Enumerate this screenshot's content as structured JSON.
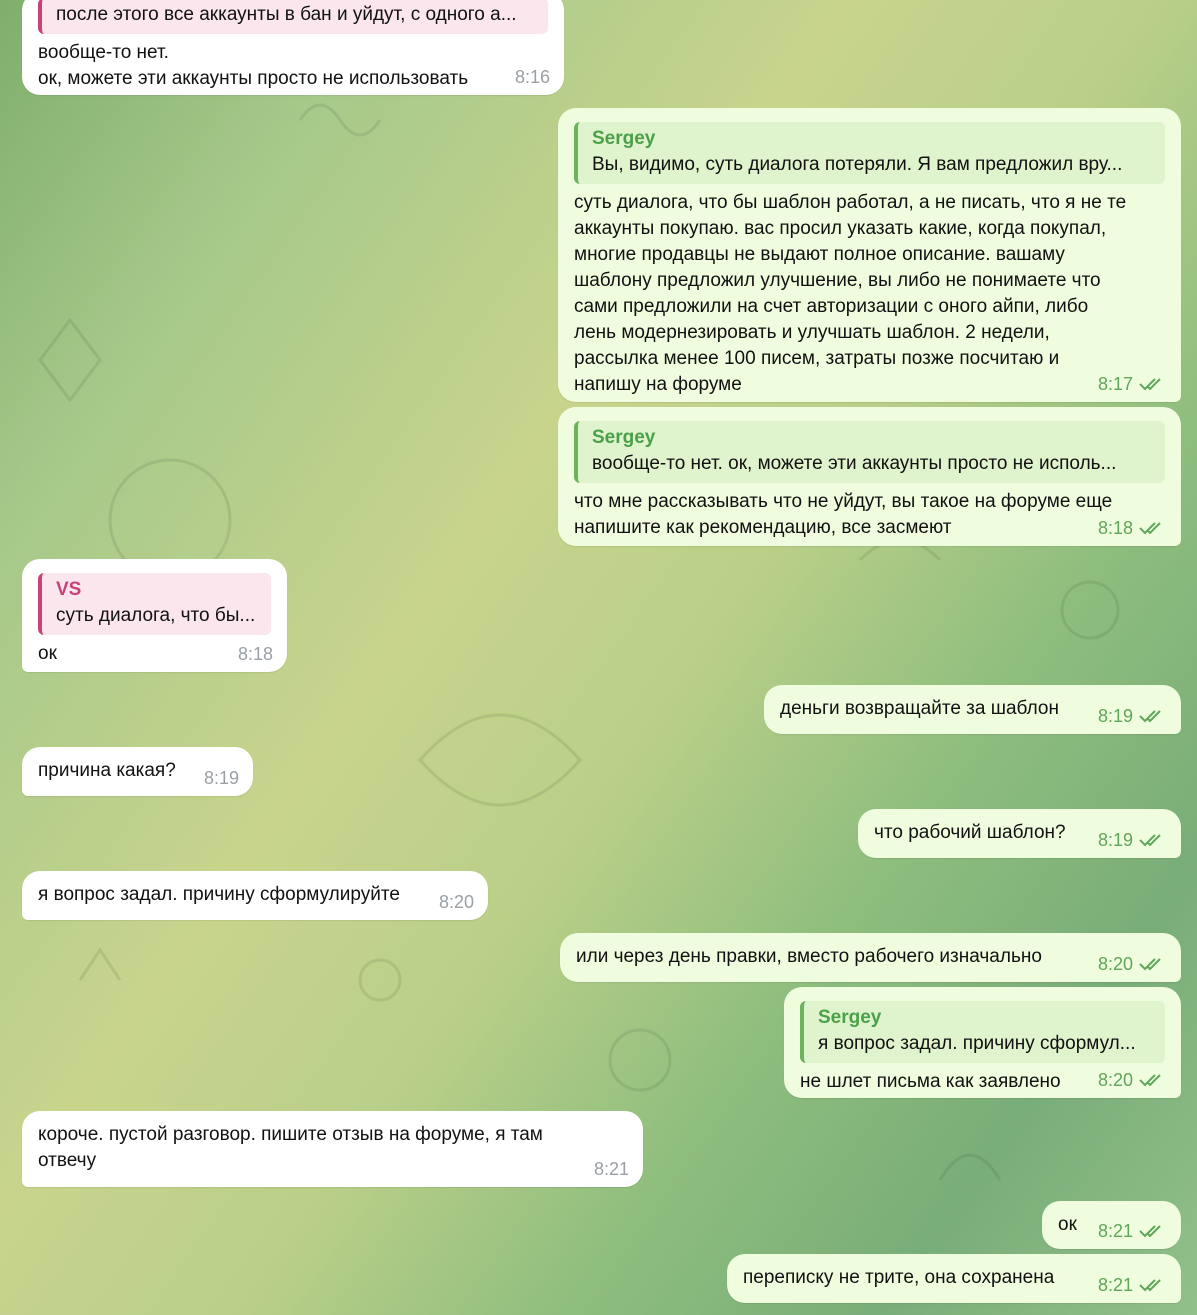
{
  "colors": {
    "incoming_bubble": "#ffffff",
    "outgoing_bubble": "#effdde",
    "outgoing_accent": "#4aa14a",
    "incoming_accent": "#c8417a",
    "incoming_time": "#9aa0a6",
    "outgoing_time": "#5fa55a"
  },
  "icons": {
    "read_receipt": "double-check-icon"
  },
  "messages": [
    {
      "id": "m1",
      "direction": "in",
      "reply_text": "после этого все аккаунты в бан и уйдут, с одного а...",
      "text": "вообще-то нет.\nок, можете эти аккаунты просто не использовать",
      "time": "8:16"
    },
    {
      "id": "m2",
      "direction": "out",
      "reply_name": "Sergey",
      "reply_text": "Вы, видимо, суть диалога потеряли.  Я вам предложил вру...",
      "text": "суть диалога, что бы шаблон работал, а не писать, что я не те\nаккаунты покупаю. вас просил указать какие, когда покупал,\nмногие продавцы не выдают полное описание. вашаму\nшаблону предложил улучшение, вы либо не понимаете что\nсами предложили на счет авторизации с оного айпи, либо\nлень модернезировать и улучшать шаблон. 2 недели,\nрассылка менее 100 писем, затраты позже посчитаю и\nнапишу на форуме",
      "time": "8:17"
    },
    {
      "id": "m3",
      "direction": "out",
      "reply_name": "Sergey",
      "reply_text": "вообще-то нет.  ок, можете эти аккаунты просто не исполь...",
      "text": "что мне рассказывать что не уйдут, вы такое на форуме еще\nнапишите как рекомендацию, все засмеют",
      "time": "8:18"
    },
    {
      "id": "m4",
      "direction": "in",
      "reply_name": "VS",
      "reply_text": "суть диалога, что бы...",
      "text": "ок",
      "time": "8:18"
    },
    {
      "id": "m5",
      "direction": "out",
      "text": "деньги возвращайте за шаблон",
      "time": "8:19"
    },
    {
      "id": "m6",
      "direction": "in",
      "text": "причина какая?",
      "time": "8:19"
    },
    {
      "id": "m7",
      "direction": "out",
      "text": "что рабочий шаблон?",
      "time": "8:19"
    },
    {
      "id": "m8",
      "direction": "in",
      "text": "я вопрос задал. причину сформулируйте",
      "time": "8:20"
    },
    {
      "id": "m9",
      "direction": "out",
      "text": "или через день правки, вместо рабочего изначально",
      "time": "8:20"
    },
    {
      "id": "m10",
      "direction": "out",
      "reply_name": "Sergey",
      "reply_text": "я вопрос задал. причину сформул...",
      "text": "не шлет письма как заявлено",
      "time": "8:20"
    },
    {
      "id": "m11",
      "direction": "in",
      "text": "короче. пустой разговор. пишите отзыв на форуме, я там\nотвечу",
      "time": "8:21"
    },
    {
      "id": "m12",
      "direction": "out",
      "text": "ок",
      "time": "8:21"
    },
    {
      "id": "m13",
      "direction": "out",
      "text": "переписку не трите, она сохранена",
      "time": "8:21"
    }
  ]
}
